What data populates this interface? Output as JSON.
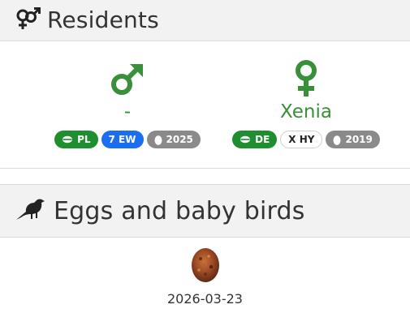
{
  "residents_section": {
    "title": "Residents",
    "icon": "gender-pair-icon"
  },
  "residents": [
    {
      "gender": "male",
      "gender_icon": "male-icon",
      "name": "-",
      "badges": [
        {
          "icon": "ring-icon",
          "label": "PL",
          "style": "green"
        },
        {
          "label": "7 EW",
          "style": "blue"
        },
        {
          "icon": "egg-icon",
          "label": "2025",
          "style": "gray"
        }
      ]
    },
    {
      "gender": "female",
      "gender_icon": "female-icon",
      "name": "Xenia",
      "badges": [
        {
          "icon": "ring-icon",
          "label": "DE",
          "style": "green"
        },
        {
          "label": "X HY",
          "style": "outline"
        },
        {
          "icon": "egg-icon",
          "label": "2019",
          "style": "gray"
        }
      ]
    }
  ],
  "eggs_section": {
    "title": "Eggs and baby birds",
    "icon": "bird-icon"
  },
  "eggs": [
    {
      "icon": "egg-photo-icon",
      "date": "2026-03-23"
    }
  ],
  "colors": {
    "accent_green": "#3a8f3a",
    "badge_green": "#1e8e2e",
    "badge_blue": "#1a6ff0",
    "badge_gray": "#8a8a8a",
    "header_bg": "#f2f2f2"
  }
}
